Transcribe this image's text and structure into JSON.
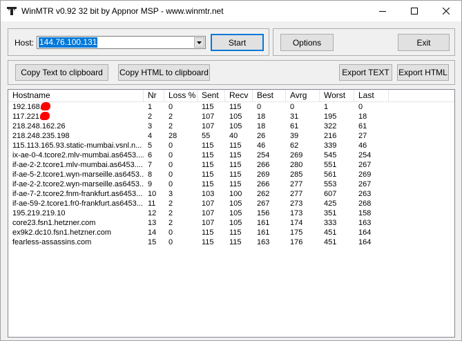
{
  "window": {
    "title": "WinMTR v0.92 32 bit by Appnor MSP - www.winmtr.net",
    "icon": "winmtr-app-icon",
    "controls": {
      "minimize_icon": "minimize-icon",
      "maximize_icon": "maximize-icon",
      "close_icon": "close-icon"
    }
  },
  "host_panel": {
    "label": "Host:",
    "host_value": "144.76.100.131",
    "start_label": "Start"
  },
  "actions_panel": {
    "options_label": "Options",
    "exit_label": "Exit"
  },
  "export_panel": {
    "copy_text_label": "Copy Text to clipboard",
    "copy_html_label": "Copy HTML to clipboard",
    "export_text_label": "Export TEXT",
    "export_html_label": "Export HTML"
  },
  "table": {
    "columns": [
      "Hostname",
      "Nr",
      "Loss %",
      "Sent",
      "Recv",
      "Best",
      "Avrg",
      "Worst",
      "Last"
    ],
    "rows": [
      {
        "hostname": "192.168.",
        "redacted": true,
        "nr": "1",
        "loss": "0",
        "sent": "115",
        "recv": "115",
        "best": "0",
        "avrg": "0",
        "worst": "1",
        "last": "0"
      },
      {
        "hostname": "117.221.",
        "redacted": true,
        "nr": "2",
        "loss": "2",
        "sent": "107",
        "recv": "105",
        "best": "18",
        "avrg": "31",
        "worst": "195",
        "last": "18"
      },
      {
        "hostname": "218.248.162.26",
        "redacted": false,
        "nr": "3",
        "loss": "2",
        "sent": "107",
        "recv": "105",
        "best": "18",
        "avrg": "61",
        "worst": "322",
        "last": "61"
      },
      {
        "hostname": "218.248.235.198",
        "redacted": false,
        "nr": "4",
        "loss": "28",
        "sent": "55",
        "recv": "40",
        "best": "26",
        "avrg": "39",
        "worst": "216",
        "last": "27"
      },
      {
        "hostname": "115.113.165.93.static-mumbai.vsnl.n...",
        "redacted": false,
        "nr": "5",
        "loss": "0",
        "sent": "115",
        "recv": "115",
        "best": "46",
        "avrg": "62",
        "worst": "339",
        "last": "46"
      },
      {
        "hostname": "ix-ae-0-4.tcore2.mlv-mumbai.as6453....",
        "redacted": false,
        "nr": "6",
        "loss": "0",
        "sent": "115",
        "recv": "115",
        "best": "254",
        "avrg": "269",
        "worst": "545",
        "last": "254"
      },
      {
        "hostname": "if-ae-2-2.tcore1.mlv-mumbai.as6453....",
        "redacted": false,
        "nr": "7",
        "loss": "0",
        "sent": "115",
        "recv": "115",
        "best": "266",
        "avrg": "280",
        "worst": "551",
        "last": "267"
      },
      {
        "hostname": "if-ae-5-2.tcore1.wyn-marseille.as6453...",
        "redacted": false,
        "nr": "8",
        "loss": "0",
        "sent": "115",
        "recv": "115",
        "best": "269",
        "avrg": "285",
        "worst": "561",
        "last": "269"
      },
      {
        "hostname": "if-ae-2-2.tcore2.wyn-marseille.as6453...",
        "redacted": false,
        "nr": "9",
        "loss": "0",
        "sent": "115",
        "recv": "115",
        "best": "266",
        "avrg": "277",
        "worst": "553",
        "last": "267"
      },
      {
        "hostname": "if-ae-7-2.tcore2.fnm-frankfurt.as6453...",
        "redacted": false,
        "nr": "10",
        "loss": "3",
        "sent": "103",
        "recv": "100",
        "best": "262",
        "avrg": "277",
        "worst": "607",
        "last": "263"
      },
      {
        "hostname": "if-ae-59-2.tcore1.fr0-frankfurt.as6453...",
        "redacted": false,
        "nr": "11",
        "loss": "2",
        "sent": "107",
        "recv": "105",
        "best": "267",
        "avrg": "273",
        "worst": "425",
        "last": "268"
      },
      {
        "hostname": "195.219.219.10",
        "redacted": false,
        "nr": "12",
        "loss": "2",
        "sent": "107",
        "recv": "105",
        "best": "156",
        "avrg": "173",
        "worst": "351",
        "last": "158"
      },
      {
        "hostname": "core23.fsn1.hetzner.com",
        "redacted": false,
        "nr": "13",
        "loss": "2",
        "sent": "107",
        "recv": "105",
        "best": "161",
        "avrg": "174",
        "worst": "333",
        "last": "163"
      },
      {
        "hostname": "ex9k2.dc10.fsn1.hetzner.com",
        "redacted": false,
        "nr": "14",
        "loss": "0",
        "sent": "115",
        "recv": "115",
        "best": "161",
        "avrg": "175",
        "worst": "451",
        "last": "164"
      },
      {
        "hostname": "fearless-assassins.com",
        "redacted": false,
        "nr": "15",
        "loss": "0",
        "sent": "115",
        "recv": "115",
        "best": "163",
        "avrg": "176",
        "worst": "451",
        "last": "164"
      }
    ]
  }
}
